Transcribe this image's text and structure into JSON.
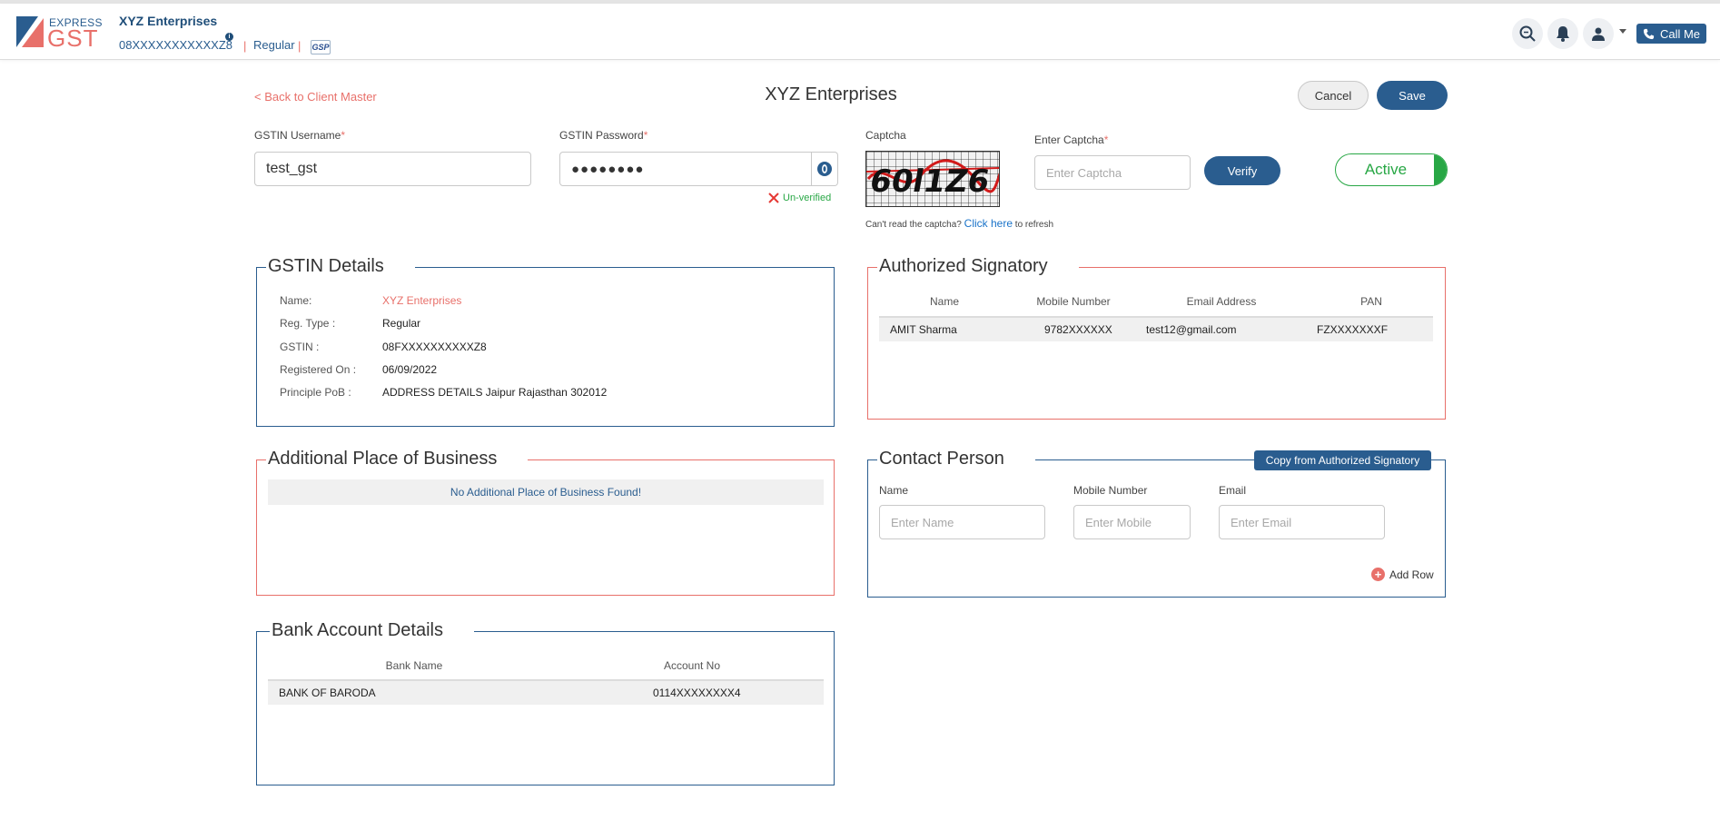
{
  "header": {
    "logo_top": "EXPRESS",
    "logo_bottom": "GST",
    "firm_name": "XYZ Enterprises",
    "gstin": "08XXXXXXXXXXXZ8",
    "info_icon": "i",
    "taxpayer_type": "Regular",
    "gsp_badge": "GSP",
    "call_me": "Call Me",
    "icons": [
      "search-icon",
      "bell-icon",
      "user-icon",
      "phone-icon"
    ]
  },
  "page": {
    "back_link": "< Back to Client Master",
    "title": "XYZ Enterprises",
    "cancel": "Cancel",
    "save": "Save"
  },
  "credentials": {
    "username_label": "GSTIN Username",
    "username_value": "test_gst",
    "password_label": "GSTIN Password",
    "password_value": "●●●●●●●●",
    "status": "Un-verified",
    "captcha_label": "Captcha",
    "captcha_hint_pre": "Can't read the captcha?",
    "captcha_hint_link": "Click here",
    "captcha_hint_post": "to refresh",
    "enter_captcha_label": "Enter Captcha",
    "enter_captcha_placeholder": "Enter Captcha",
    "verify": "Verify",
    "active_toggle": "Active"
  },
  "gstin_details": {
    "title": "GSTIN Details",
    "rows": [
      {
        "key": "Name:",
        "value": "XYZ Enterprises"
      },
      {
        "key": "Reg. Type :",
        "value": "Regular"
      },
      {
        "key": "GSTIN :",
        "value": "08FXXXXXXXXXXZ8"
      },
      {
        "key": "Registered On :",
        "value": "06/09/2022"
      },
      {
        "key": "Principle PoB :",
        "value": "ADDRESS DETAILS Jaipur Rajasthan 302012"
      }
    ]
  },
  "authorized_signatory": {
    "title": "Authorized Signatory",
    "columns": [
      "Name",
      "Mobile Number",
      "Email Address",
      "PAN"
    ],
    "rows": [
      [
        "AMIT Sharma",
        "9782XXXXXX",
        "test12@gmail.com",
        "FZXXXXXXXF"
      ]
    ]
  },
  "additional_pob": {
    "title": "Additional Place of Business",
    "empty_message": "No Additional Place of Business Found!"
  },
  "contact_person": {
    "title": "Contact Person",
    "copy_button": "Copy from Authorized Signatory",
    "name_label": "Name",
    "name_placeholder": "Enter Name",
    "mobile_label": "Mobile Number",
    "mobile_placeholder": "Enter Mobile",
    "email_label": "Email",
    "email_placeholder": "Enter Email",
    "add_row": "Add Row"
  },
  "bank_details": {
    "title": "Bank Account Details",
    "columns": [
      "Bank Name",
      "Account No"
    ],
    "rows": [
      [
        "BANK OF BARODA",
        "0114XXXXXXXX4"
      ]
    ]
  },
  "colors": {
    "primary": "#2a5d8f",
    "accent": "#e8706a",
    "success": "#28a745"
  }
}
